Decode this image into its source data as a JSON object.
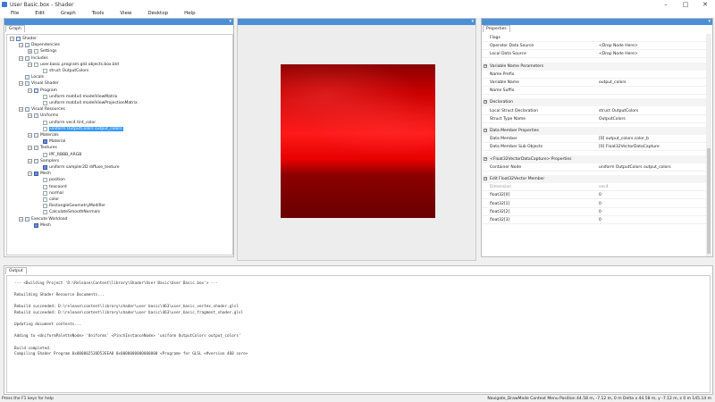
{
  "window": {
    "title": "User Basic.box - Shader",
    "controls": [
      "–",
      "□",
      "✕"
    ]
  },
  "menu": [
    "File",
    "Edit",
    "Graph",
    "Tools",
    "View",
    "Desktop",
    "Help"
  ],
  "graph": {
    "tab": "Graph",
    "nodes": [
      {
        "label": "Shader",
        "depth": 0,
        "exp": "−",
        "icon": "shader"
      },
      {
        "label": "Dependencies",
        "depth": 1,
        "exp": "−",
        "icon": "folder"
      },
      {
        "label": "Settings",
        "depth": 2,
        "exp": "+",
        "icon": "file"
      },
      {
        "label": "Includes",
        "depth": 1,
        "exp": "−",
        "icon": "folder"
      },
      {
        "label": "user.basic.program.glsl.objects.box.bld",
        "depth": 2,
        "exp": "−",
        "icon": "file"
      },
      {
        "label": "struct OutputColors",
        "depth": 3,
        "exp": "",
        "icon": "file"
      },
      {
        "label": "Locals",
        "depth": 1,
        "exp": "",
        "icon": "folder"
      },
      {
        "label": "Visual Shader",
        "depth": 1,
        "exp": "−",
        "icon": "folder"
      },
      {
        "label": "Program",
        "depth": 2,
        "exp": "−",
        "icon": "shader"
      },
      {
        "label": "uniform mat4x4 modelViewMatrix",
        "depth": 3,
        "exp": "",
        "icon": "file"
      },
      {
        "label": "uniform mat4x4 modelViewProjectionMatrix",
        "depth": 3,
        "exp": "",
        "icon": "file"
      },
      {
        "label": "Visual Resources",
        "depth": 1,
        "exp": "−",
        "icon": "folder"
      },
      {
        "label": "Uniforms",
        "depth": 2,
        "exp": "−",
        "icon": "folder"
      },
      {
        "label": "uniform vec4 tint_color",
        "depth": 3,
        "exp": "",
        "icon": "file"
      },
      {
        "label": "uniform OutputColors output_colors",
        "depth": 3,
        "exp": "",
        "icon": "file",
        "selected": true
      },
      {
        "label": "Materials",
        "depth": 2,
        "exp": "−",
        "icon": "folder"
      },
      {
        "label": "Material",
        "depth": 3,
        "exp": "",
        "icon": "blue"
      },
      {
        "label": "Textures",
        "depth": 2,
        "exp": "−",
        "icon": "folder"
      },
      {
        "label": "IPF_RBBB_ARGB",
        "depth": 3,
        "exp": "",
        "icon": "file"
      },
      {
        "label": "Samplers",
        "depth": 2,
        "exp": "−",
        "icon": "folder"
      },
      {
        "label": "uniform sampler2D diffuse_texture",
        "depth": 3,
        "exp": "",
        "icon": "blue"
      },
      {
        "label": "Mesh",
        "depth": 2,
        "exp": "−",
        "icon": "blue"
      },
      {
        "label": "position",
        "depth": 3,
        "exp": "",
        "icon": "file"
      },
      {
        "label": "texcoord",
        "depth": 3,
        "exp": "",
        "icon": "file"
      },
      {
        "label": "normal",
        "depth": 3,
        "exp": "",
        "icon": "file"
      },
      {
        "label": "color",
        "depth": 3,
        "exp": "",
        "icon": "file"
      },
      {
        "label": "RectangleGeometryModifier",
        "depth": 3,
        "exp": "",
        "icon": "file"
      },
      {
        "label": "CalculateSmoothNormals",
        "depth": 3,
        "exp": "",
        "icon": "file"
      },
      {
        "label": "Execute Workload",
        "depth": 1,
        "exp": "−",
        "icon": "folder"
      },
      {
        "label": "Mesh",
        "depth": 2,
        "exp": "",
        "icon": "blue"
      }
    ]
  },
  "properties": {
    "tab": "Properties",
    "rows": [
      {
        "kind": "row",
        "k": "Flags",
        "v": ""
      },
      {
        "kind": "row",
        "k": "Operator Data Source",
        "v": "<Drop Node Here>"
      },
      {
        "kind": "row",
        "k": "Local Data Source",
        "v": "<Drop Node Here>"
      },
      {
        "kind": "gap"
      },
      {
        "kind": "cat",
        "k": "Variable Name Parameters"
      },
      {
        "kind": "row",
        "k": "Name Prefix",
        "v": ""
      },
      {
        "kind": "row",
        "k": "Variable Name",
        "v": "output_colors"
      },
      {
        "kind": "row",
        "k": "Name Suffix",
        "v": ""
      },
      {
        "kind": "gap"
      },
      {
        "kind": "cat",
        "k": "Declaration"
      },
      {
        "kind": "row",
        "k": "Local Struct Declaration",
        "v": "struct OutputColors"
      },
      {
        "kind": "row",
        "k": "Struct Type Name",
        "v": "OutputColors"
      },
      {
        "kind": "gap"
      },
      {
        "kind": "cat",
        "k": "Data Member Properties"
      },
      {
        "kind": "row",
        "k": "Data Member",
        "v": "[0] output_colors.color_b"
      },
      {
        "kind": "row",
        "k": "Data Member Sub Objects",
        "v": "[0] Float32VectorDataCapture"
      },
      {
        "kind": "gap"
      },
      {
        "kind": "cat",
        "k": "<Float32VectorDataCapture> Properties"
      },
      {
        "kind": "row",
        "k": "Container Node",
        "v": "uniform OutputColors output_colors"
      },
      {
        "kind": "gap"
      },
      {
        "kind": "cat",
        "k": "Edit Float32Vector Member"
      },
      {
        "kind": "row",
        "k": "Dimension",
        "v": "vec4",
        "dim": true
      },
      {
        "kind": "row",
        "k": "float32[0]",
        "v": "0"
      },
      {
        "kind": "row",
        "k": "float32[1]",
        "v": "0"
      },
      {
        "kind": "row",
        "k": "float32[2]",
        "v": "0"
      },
      {
        "kind": "row",
        "k": "float32[3]",
        "v": "0"
      }
    ]
  },
  "output": {
    "tab": "Output",
    "lines": [
      "--- <Building Project 'D:\\Release\\Content\\library\\Shader\\User Basic\\User Basic.box'> ---",
      "",
      "Rebuilding Shader Resource Documents...",
      "",
      "Rebuild succeeded: D:\\release\\content\\library\\shader\\user basic\\463\\user_basic_vertex_shader.glsl",
      "Rebuild succeeded: D:\\release\\content\\library\\shader\\user basic\\463\\user_basic_fragment_shader.glsl",
      "",
      "Updating document contents...",
      "",
      "Adding to <UniformPaletteNode> 'Uniforms' <PinchInstanceNode> 'uniform OutputColors output_colors'",
      "",
      "Build completed.",
      "Compiling Shader Program 0x000002520D52EEA0 0x0000000000000000 <Program> for GLSL <#version 460 core>"
    ]
  },
  "status": {
    "left": "Press the F1 keys for help",
    "right": "Navigate_DrawMode Context Menu  Position 44.58 m, -7.12 m, 0 m  Delta x 44.58 m, y -7.12 m, z 0 m  145.14 m"
  }
}
